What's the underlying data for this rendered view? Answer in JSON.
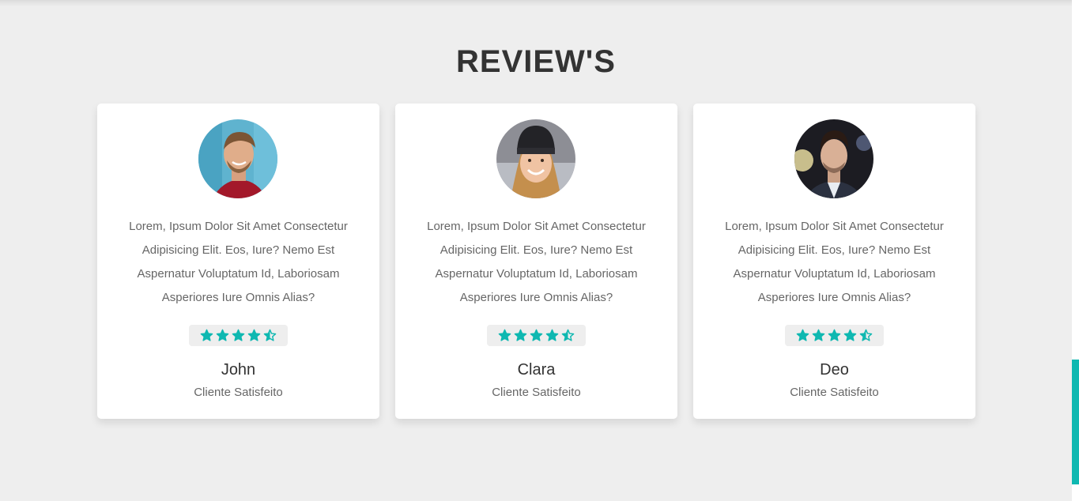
{
  "section": {
    "title": "REVIEW'S"
  },
  "colors": {
    "accent": "#0fb8b1",
    "background": "#eeeeee",
    "card": "#ffffff",
    "heading": "#333333",
    "body_text": "#666666"
  },
  "reviews": [
    {
      "avatar_icon": "man-smiling-photo",
      "text": "Lorem, Ipsum Dolor Sit Amet Consectetur Adipisicing Elit. Eos, Iure? Nemo Est Aspernatur Voluptatum Id, Laboriosam Asperiores Iure Omnis Alias?",
      "rating": 4.5,
      "rating_max": 5,
      "name": "John",
      "role": "Cliente Satisfeito"
    },
    {
      "avatar_icon": "woman-beanie-photo",
      "text": "Lorem, Ipsum Dolor Sit Amet Consectetur Adipisicing Elit. Eos, Iure? Nemo Est Aspernatur Voluptatum Id, Laboriosam Asperiores Iure Omnis Alias?",
      "rating": 4.5,
      "rating_max": 5,
      "name": "Clara",
      "role": "Cliente Satisfeito"
    },
    {
      "avatar_icon": "man-portrait-photo",
      "text": "Lorem, Ipsum Dolor Sit Amet Consectetur Adipisicing Elit. Eos, Iure? Nemo Est Aspernatur Voluptatum Id, Laboriosam Asperiores Iure Omnis Alias?",
      "rating": 4.5,
      "rating_max": 5,
      "name": "Deo",
      "role": "Cliente Satisfeito"
    }
  ]
}
